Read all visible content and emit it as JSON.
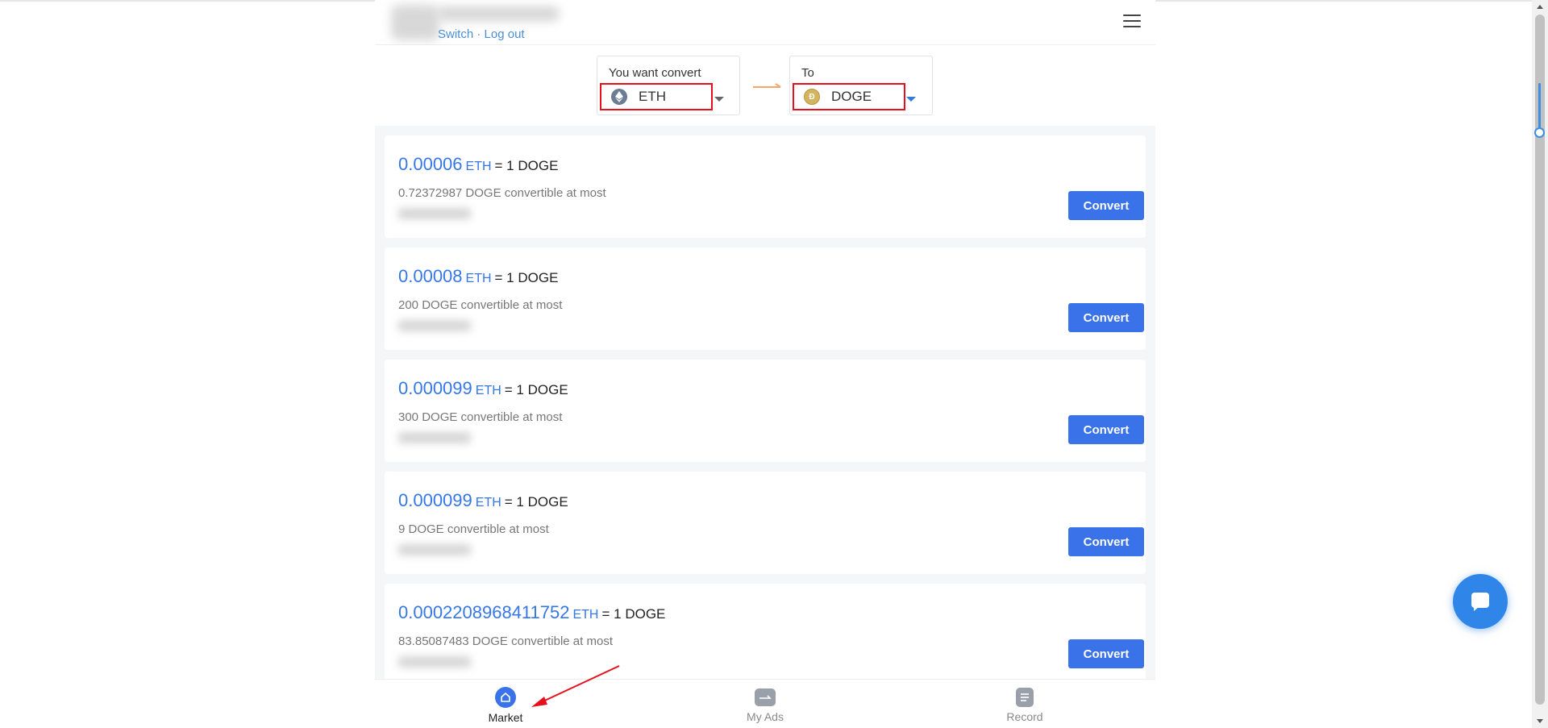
{
  "header": {
    "switch_label": "Switch",
    "separator": " · ",
    "logout_label": "Log out"
  },
  "convert": {
    "from_label": "You want convert",
    "from_coin": "ETH",
    "to_label": "To",
    "to_coin": "DOGE"
  },
  "offers": [
    {
      "rate": "0.00006",
      "unit": "ETH",
      "eq": "= 1 DOGE",
      "limit": "0.72372987 DOGE convertible at most",
      "button": "Convert"
    },
    {
      "rate": "0.00008",
      "unit": "ETH",
      "eq": "= 1 DOGE",
      "limit": "200 DOGE convertible at most",
      "button": "Convert"
    },
    {
      "rate": "0.000099",
      "unit": "ETH",
      "eq": "= 1 DOGE",
      "limit": "300 DOGE convertible at most",
      "button": "Convert"
    },
    {
      "rate": "0.000099",
      "unit": "ETH",
      "eq": "= 1 DOGE",
      "limit": "9 DOGE convertible at most",
      "button": "Convert"
    },
    {
      "rate": "0.0002208968411752",
      "unit": "ETH",
      "eq": "= 1 DOGE",
      "limit": "83.85087483 DOGE convertible at most",
      "button": "Convert"
    }
  ],
  "nav": {
    "market": "Market",
    "my_ads": "My Ads",
    "record": "Record"
  },
  "colors": {
    "accent": "#3a73e9",
    "rate_blue": "#3577e6",
    "highlight_red": "#e5101b",
    "arrow_orange": "#f5a66b"
  },
  "icons": [
    "menu-icon",
    "eth-icon",
    "doge-icon",
    "arrow-right-icon",
    "market-icon",
    "my-ads-icon",
    "record-icon",
    "chat-icon"
  ]
}
